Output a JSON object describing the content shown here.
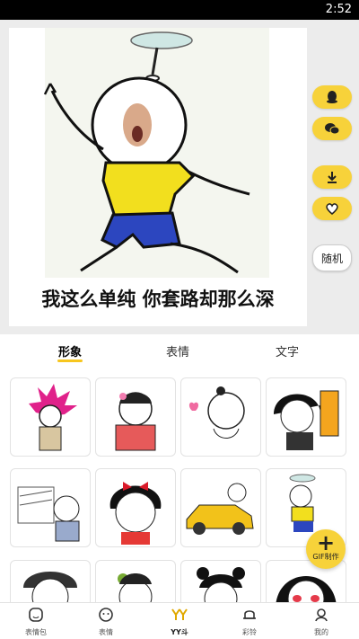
{
  "status_bar": {
    "time": "2:52"
  },
  "meme": {
    "caption": "我这么单纯 你套路却那么深"
  },
  "side_actions": {
    "random_label": "随机"
  },
  "tabs": [
    {
      "label": "形象",
      "active": true
    },
    {
      "label": "表情",
      "active": false
    },
    {
      "label": "文字",
      "active": false
    }
  ],
  "gif_button": {
    "label": "GIF制作"
  },
  "bottom_nav": [
    {
      "label": "表情包",
      "icon": "face-icon"
    },
    {
      "label": "表情",
      "icon": "smiley-icon"
    },
    {
      "label": "YY斗",
      "icon": "yy-icon",
      "active": true
    },
    {
      "label": "彩铃",
      "icon": "bell-icon"
    },
    {
      "label": "我的",
      "icon": "profile-icon"
    }
  ],
  "colors": {
    "accent": "#f7d23a",
    "active_underline": "#f7c61e"
  }
}
